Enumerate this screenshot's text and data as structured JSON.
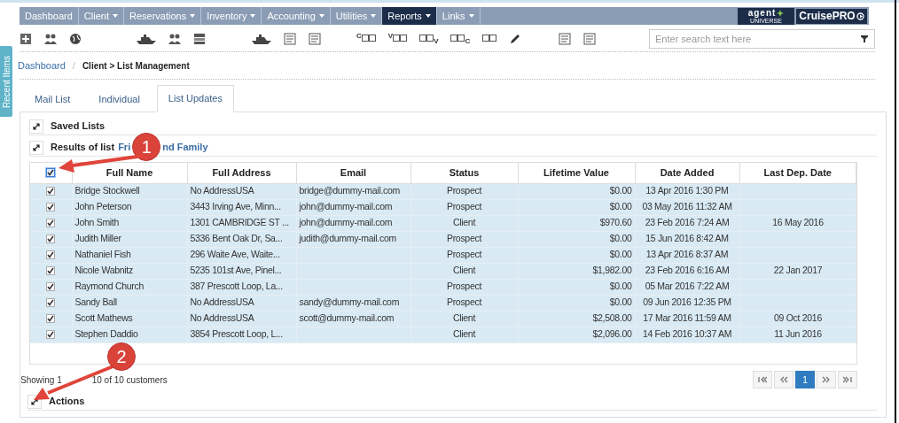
{
  "side_tab": {
    "label": "Recent Items"
  },
  "nav": [
    {
      "label": "Dashboard",
      "dropdown": false,
      "selected": false
    },
    {
      "label": "Client",
      "dropdown": true,
      "selected": false
    },
    {
      "label": "Reservations",
      "dropdown": true,
      "selected": false
    },
    {
      "label": "Inventory",
      "dropdown": true,
      "selected": false
    },
    {
      "label": "Accounting",
      "dropdown": true,
      "selected": false
    },
    {
      "label": "Utilities",
      "dropdown": true,
      "selected": false
    },
    {
      "label": "Reports",
      "dropdown": true,
      "selected": true
    },
    {
      "label": "Links",
      "dropdown": true,
      "selected": false
    }
  ],
  "logos": {
    "agent": "agent",
    "agent_sub": "UNIVERSE",
    "cruise": "CruisePRO"
  },
  "toolbar_groups": [
    [
      {
        "kind": "add"
      },
      {
        "kind": "people"
      },
      {
        "kind": "globe"
      }
    ],
    [
      {
        "kind": "ship"
      },
      {
        "kind": "people"
      },
      {
        "kind": "stack"
      }
    ],
    [
      {
        "kind": "ship"
      },
      {
        "kind": "doc"
      },
      {
        "kind": "doc"
      }
    ],
    [
      {
        "kind": "frame",
        "prefix": "C"
      },
      {
        "kind": "frame",
        "prefix": "V"
      },
      {
        "kind": "frame",
        "suffix": "V"
      },
      {
        "kind": "frame",
        "suffix": "C"
      },
      {
        "kind": "frame"
      },
      {
        "kind": "pencil"
      }
    ],
    [
      {
        "kind": "doc"
      },
      {
        "kind": "doc"
      }
    ]
  ],
  "search": {
    "placeholder": "Enter search text here"
  },
  "breadcrumb": {
    "link": "Dashboard",
    "separator": "/",
    "current": "Client > List Management"
  },
  "tabs": [
    {
      "label": "Mail List",
      "selected": false
    },
    {
      "label": "Individual",
      "selected": false
    },
    {
      "label": "List Updates",
      "selected": true
    }
  ],
  "saved_lists": {
    "title": "Saved Lists"
  },
  "results": {
    "title": "Results of list",
    "list_name_start": "Fri",
    "list_name_end": "nd Family"
  },
  "table": {
    "all_checked": true,
    "columns": [
      "Full Name",
      "Full Address",
      "Email",
      "Status",
      "Lifetime Value",
      "Date Added",
      "Last Dep. Date"
    ],
    "rows": [
      {
        "checked": true,
        "selected": true,
        "cells": [
          "Bridge Stockwell",
          "No AddressUSA",
          "bridge@dummy-mail.com",
          "Prospect",
          "$0.00",
          "13 Apr 2016 1:30 PM",
          ""
        ]
      },
      {
        "checked": true,
        "selected": true,
        "cells": [
          "John Peterson",
          "3443 Irving Ave, Minn...",
          "john@dummy-mail.com",
          "Prospect",
          "$0.00",
          "03 May 2016 11:32 AM",
          ""
        ]
      },
      {
        "checked": true,
        "selected": true,
        "cells": [
          "John Smith",
          "1301 CAMBRIDGE ST ...",
          "john@dummy-mail.com",
          "Client",
          "$970.60",
          "23 Feb 2016 7:24 AM",
          "16 May 2016"
        ]
      },
      {
        "checked": true,
        "selected": true,
        "cells": [
          "Judith Miller",
          "5336 Bent Oak Dr, Sa...",
          "judith@dummy-mail.com",
          "Prospect",
          "$0.00",
          "15 Jun 2016 8:42 AM",
          ""
        ]
      },
      {
        "checked": true,
        "selected": true,
        "cells": [
          "Nathaniel Fish",
          "296 Waite Ave, Waite...",
          "",
          "Prospect",
          "$0.00",
          "13 Apr 2016 8:37 AM",
          ""
        ]
      },
      {
        "checked": true,
        "selected": true,
        "cells": [
          "Nicole Wabnitz",
          "5235 101st Ave, Pinel...",
          "",
          "Client",
          "$1,982.00",
          "23 Feb 2016 6:16 AM",
          "22 Jan 2017"
        ]
      },
      {
        "checked": true,
        "selected": true,
        "cells": [
          "Raymond Church",
          "387 Prescott Loop, La...",
          "",
          "Prospect",
          "$0.00",
          "05 Mar 2016 7:22 AM",
          ""
        ]
      },
      {
        "checked": true,
        "selected": true,
        "cells": [
          "Sandy Ball",
          "No AddressUSA",
          "sandy@dummy-mail.com",
          "Prospect",
          "$0.00",
          "09 Jun 2016 12:35 PM",
          ""
        ]
      },
      {
        "checked": true,
        "selected": true,
        "cells": [
          "Scott Mathews",
          "No AddressUSA",
          "scott@dummy-mail.com",
          "Client",
          "$2,508.00",
          "17 Mar 2016 11:59 AM",
          "09 Oct 2016"
        ]
      },
      {
        "checked": true,
        "selected": true,
        "cells": [
          "Stephen Daddio",
          "3854 Prescott Loop, L...",
          "",
          "Client",
          "$2,096.00",
          "14 Feb 2016 10:37 AM",
          "11 Jun 2016"
        ]
      }
    ]
  },
  "summary": {
    "start": "Showing 1",
    "end": "10 of 10 customers"
  },
  "pager": [
    {
      "kind": "first",
      "selected": false
    },
    {
      "kind": "prev",
      "selected": false
    },
    {
      "kind": "page",
      "label": "1",
      "selected": true
    },
    {
      "kind": "next",
      "selected": false
    },
    {
      "kind": "last",
      "selected": false
    }
  ],
  "actions": {
    "title": "Actions"
  },
  "callouts": [
    {
      "number": "1"
    },
    {
      "number": "2"
    }
  ]
}
